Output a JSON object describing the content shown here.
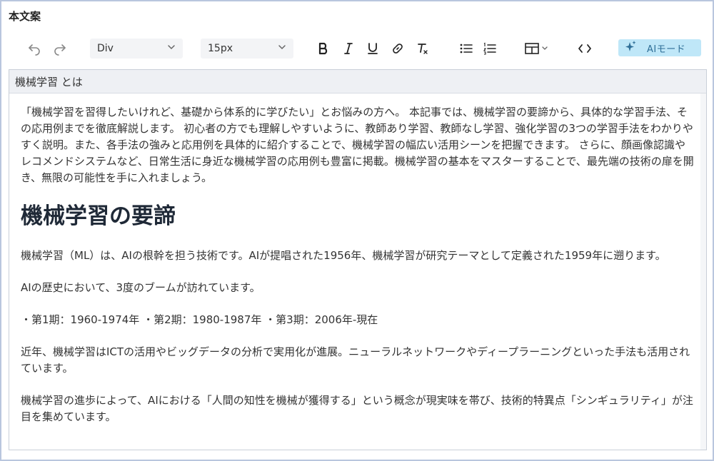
{
  "label": "本文案",
  "toolbar": {
    "block_select": "Div",
    "size_select": "15px",
    "ai_button": "AIモード"
  },
  "editor": {
    "title": "機械学習 とは",
    "intro": "「機械学習を習得したいけれど、基礎から体系的に学びたい」とお悩みの方へ。 本記事では、機械学習の要諦から、具体的な学習手法、その応用例までを徹底解説します。 初心者の方でも理解しやすいように、教師あり学習、教師なし学習、強化学習の3つの学習手法をわかりやすく説明。また、各手法の強みと応用例を具体的に紹介することで、機械学習の幅広い活用シーンを把握できます。 さらに、顔画像認識やレコメンドシステムなど、日常生活に身近な機械学習の応用例も豊富に掲載。機械学習の基本をマスターすることで、最先端の技術の扉を開き、無限の可能性を手に入れましょう。",
    "heading": "機械学習の要諦",
    "p1": "機械学習（ML）は、AIの根幹を担う技術です。AIが提唱された1956年、機械学習が研究テーマとして定義された1959年に遡ります。",
    "p2": "AIの歴史において、3度のブームが訪れています。",
    "p3": "・第1期：1960-1974年 ・第2期：1980-1987年 ・第3期：2006年-現在",
    "p4": "近年、機械学習はICTの活用やビッグデータの分析で実用化が進展。ニューラルネットワークやディープラーニングといった手法も活用されています。",
    "p5": "機械学習の進歩によって、AIにおける「人間の知性を機械が獲得する」という概念が現実味を帯び、技術的特異点「シンギュラリティ」が注目を集めています。"
  },
  "colors": {
    "accent": "#bfe7f8",
    "ai_text": "#2f6f97",
    "frame_border": "#b9c6de"
  },
  "icons": [
    "undo-icon",
    "redo-icon",
    "bold-icon",
    "italic-icon",
    "underline-icon",
    "link-icon",
    "clear-format-icon",
    "bullet-list-icon",
    "numbered-list-icon",
    "table-icon",
    "code-icon",
    "sparkle-icon"
  ]
}
